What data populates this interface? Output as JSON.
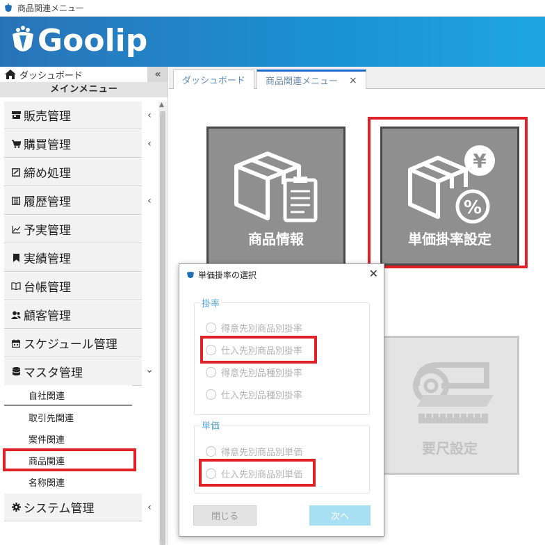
{
  "window": {
    "title": "商品関連メニュー"
  },
  "header": {
    "logo": "Goolip"
  },
  "sidebar": {
    "dashboard": "ダッシュボード",
    "collapse": "«",
    "menu_title": "メインメニュー",
    "items": [
      {
        "label": "販売管理",
        "icon": "shop-icon",
        "chevron": "‹"
      },
      {
        "label": "購買管理",
        "icon": "cart-icon",
        "chevron": "‹"
      },
      {
        "label": "締め処理",
        "icon": "check-box-icon",
        "chevron": ""
      },
      {
        "label": "履歴管理",
        "icon": "history-icon",
        "chevron": "‹"
      },
      {
        "label": "予実管理",
        "icon": "chart-line-icon",
        "chevron": ""
      },
      {
        "label": "実績管理",
        "icon": "bookmark-icon",
        "chevron": ""
      },
      {
        "label": "台帳管理",
        "icon": "book-icon",
        "chevron": ""
      },
      {
        "label": "顧客管理",
        "icon": "people-icon",
        "chevron": ""
      },
      {
        "label": "スケジュール管理",
        "icon": "calendar-icon",
        "chevron": ""
      },
      {
        "label": "マスタ管理",
        "icon": "database-icon",
        "chevron": "⌄"
      }
    ],
    "sub_items": [
      "自社関連",
      "取引先関連",
      "案件関連",
      "商品関連",
      "名称関連"
    ],
    "system": {
      "label": "システム管理",
      "icon": "gear-icon",
      "chevron": "‹"
    }
  },
  "tabs": [
    {
      "label": "ダッシュボード"
    },
    {
      "label": "商品関連メニュー",
      "close": "×"
    }
  ],
  "tiles": [
    {
      "label": "商品情報",
      "icon": "box-clipboard-icon"
    },
    {
      "label": "単価掛率設定",
      "icon": "box-yen-percent-icon"
    },
    {
      "label": "要尺設定",
      "icon": "fabric-roll-icon"
    }
  ],
  "dialog": {
    "title": "単価掛率の選択",
    "close": "✕",
    "group_rate": {
      "label": "掛率",
      "options": [
        "得意先別商品別掛率",
        "仕入先別商品別掛率",
        "得意先別品種別掛率",
        "仕入先別品種別掛率"
      ]
    },
    "group_price": {
      "label": "単価",
      "options": [
        "得意先別商品別単価",
        "仕入先別商品別単価"
      ]
    },
    "buttons": {
      "close": "閉じる",
      "next": "次へ"
    }
  },
  "colors": {
    "header": "#1a92d2",
    "highlight": "#e02127",
    "tile": "#8f8f8f",
    "accent": "#5aa7d8"
  }
}
